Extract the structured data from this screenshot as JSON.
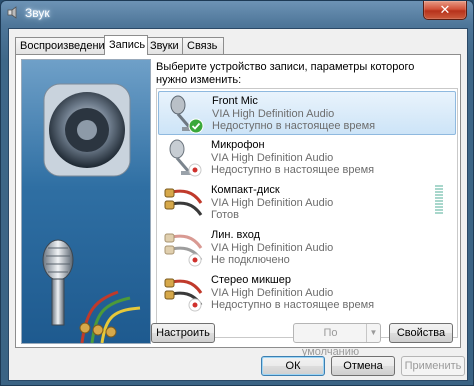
{
  "window": {
    "title": "Звук",
    "close_glyph": "✕"
  },
  "tabs": [
    {
      "label": "Воспроизведение"
    },
    {
      "label": "Запись"
    },
    {
      "label": "Звуки"
    },
    {
      "label": "Связь"
    }
  ],
  "active_tab": "Запись",
  "instruction": "Выберите устройство записи, параметры которого нужно изменить:",
  "devices": [
    {
      "name": "Front Mic",
      "driver": "VIA High Definition Audio",
      "status": "Недоступно в настоящее время",
      "icon": "microphone-icon",
      "badge": "default-check"
    },
    {
      "name": "Микрофон",
      "driver": "VIA High Definition Audio",
      "status": "Недоступно в настоящее время",
      "icon": "microphone-icon",
      "badge": "unplugged"
    },
    {
      "name": "Компакт-диск",
      "driver": "VIA High Definition Audio",
      "status": "Готов",
      "icon": "rca-cable-icon",
      "badge": "none"
    },
    {
      "name": "Лин. вход",
      "driver": "VIA High Definition Audio",
      "status": "Не подключено",
      "icon": "rca-cable-icon",
      "badge": "unplugged"
    },
    {
      "name": "Стерео микшер",
      "driver": "VIA High Definition Audio",
      "status": "Недоступно в настоящее время",
      "icon": "rca-cable-icon",
      "badge": "unplugged"
    }
  ],
  "selected_device": "Front Mic",
  "buttons": {
    "configure": "Настроить",
    "set_default": "По умолчанию",
    "properties": "Свойства",
    "ok": "ОК",
    "cancel": "Отмена",
    "apply": "Применить"
  },
  "colors": {
    "title_bar": "#4e7699",
    "selection": "#cde4f7",
    "default_check": "#3aa83a",
    "unplugged_dot": "#d0312d"
  }
}
